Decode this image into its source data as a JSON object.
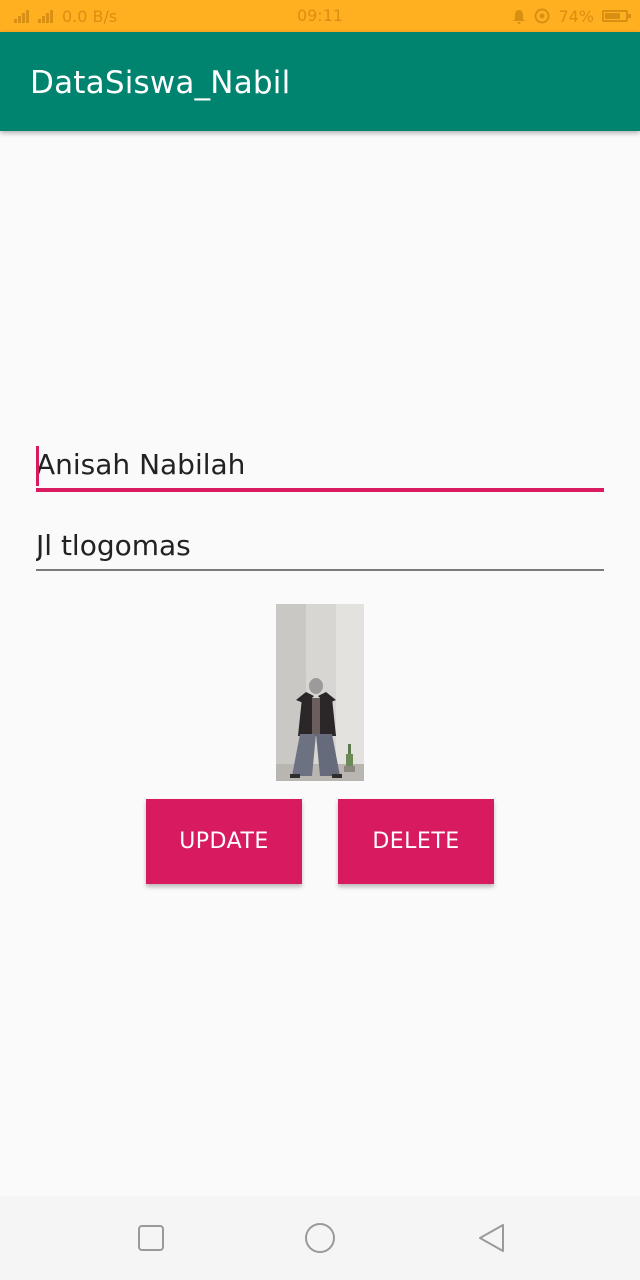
{
  "status_bar": {
    "left_text": "0.0 B/s",
    "time": "09:11",
    "battery_percent": "74%",
    "icons": [
      "signal-icon",
      "signal-icon-2",
      "bell-icon",
      "eye-icon",
      "battery-icon"
    ]
  },
  "app_bar": {
    "title": "DataSiswa_Nabil"
  },
  "form": {
    "name_value": "Anisah Nabilah",
    "address_value": "Jl tlogomas"
  },
  "photo": {
    "description_icon": "student-photo"
  },
  "actions": {
    "update_label": "UPDATE",
    "delete_label": "DELETE"
  },
  "nav_bar": {
    "icons": [
      "recent-apps-icon",
      "home-icon",
      "back-icon"
    ]
  },
  "colors": {
    "status_bar": "#FFB020",
    "primary": "#00846F",
    "accent": "#D81B60",
    "background": "#FAFAFA"
  }
}
